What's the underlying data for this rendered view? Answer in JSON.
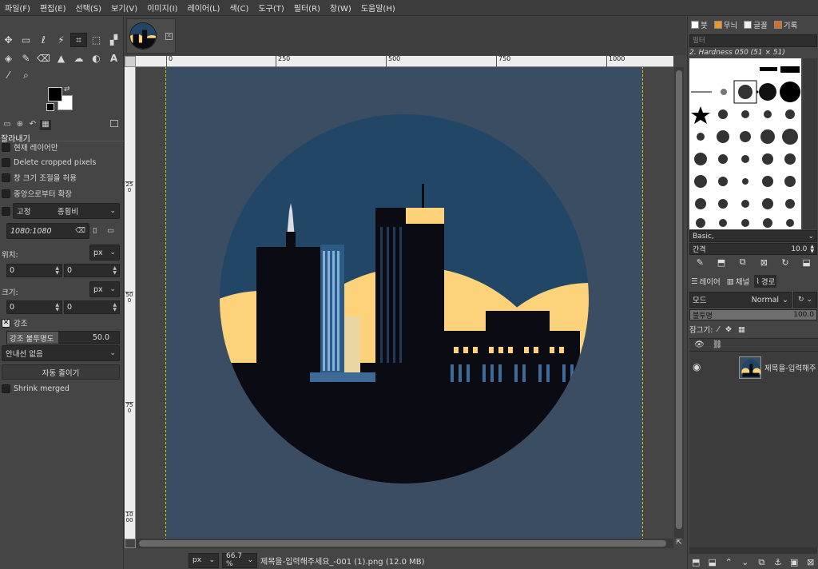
{
  "menubar": {
    "items": [
      "파일(F)",
      "편집(E)",
      "선택(S)",
      "보기(V)",
      "이미지(I)",
      "레이어(L)",
      "색(C)",
      "도구(T)",
      "필터(R)",
      "창(W)",
      "도움말(H)"
    ]
  },
  "toolbox": {
    "tools_row1": [
      "move",
      "rect-select",
      "lasso",
      "fuzzy-select",
      "crop",
      "transform",
      "text-warp",
      "text-a"
    ],
    "tools_row2": [
      "bucket-fill",
      "paintbrush",
      "eraser",
      "clone",
      "smudge",
      "dodge",
      "text"
    ],
    "tools_row3": [
      "color-picker",
      "zoom"
    ]
  },
  "tool_options": {
    "title": "잘라내기",
    "current_layer_only": "현재 레이어만",
    "delete_cropped": "Delete cropped pixels",
    "allow_growing": "창 크기 조절을 허용",
    "expand_from_center": "중앙으로부터 확장",
    "fixed_label": "고정",
    "fixed_mode": "종횡비",
    "ratio_value": "1080:1080",
    "position_label": "위치:",
    "position_unit": "px",
    "position_x": "0",
    "position_y": "0",
    "size_label": "크기:",
    "size_unit": "px",
    "size_w": "0",
    "size_h": "0",
    "highlight_label": "강조",
    "highlight_opacity_label": "강조 불투명도",
    "highlight_opacity_value": "50.0",
    "guides": "안내선 없음",
    "auto_shrink": "자동 줄이기",
    "shrink_merged": "Shrink merged"
  },
  "rulers": {
    "h_ticks": [
      "0",
      "250",
      "500",
      "750",
      "1000"
    ],
    "v_ticks": [
      "250",
      "500",
      "750",
      "1000"
    ]
  },
  "statusbar": {
    "unit": "px",
    "zoom": "66.7 %",
    "text": "제목을-입력해주세요_-001 (1).png (12.0 MB)"
  },
  "brushes": {
    "tabs": [
      "붓",
      "무늬",
      "글꼴",
      "기록"
    ],
    "filter_placeholder": "필터",
    "current_brush": "2. Hardness 050 (51 × 51)",
    "set_name": "Basic,",
    "spacing_label": "간격",
    "spacing_value": "10.0"
  },
  "layers": {
    "tabs": [
      "레이어",
      "채널",
      "경로"
    ],
    "mode_label": "모드",
    "mode_value": "Normal",
    "opacity_label": "불투명",
    "opacity_value": "100.0",
    "opacity_level": 1.0,
    "lock_label": "잠그기:",
    "layer_name": "제목을-입력해주"
  },
  "colors": {
    "image_bg": "#3a4d62",
    "sun_yellow": "#fcd27a",
    "sky_blue": "#224766",
    "building_dark": "#0b0b14"
  }
}
